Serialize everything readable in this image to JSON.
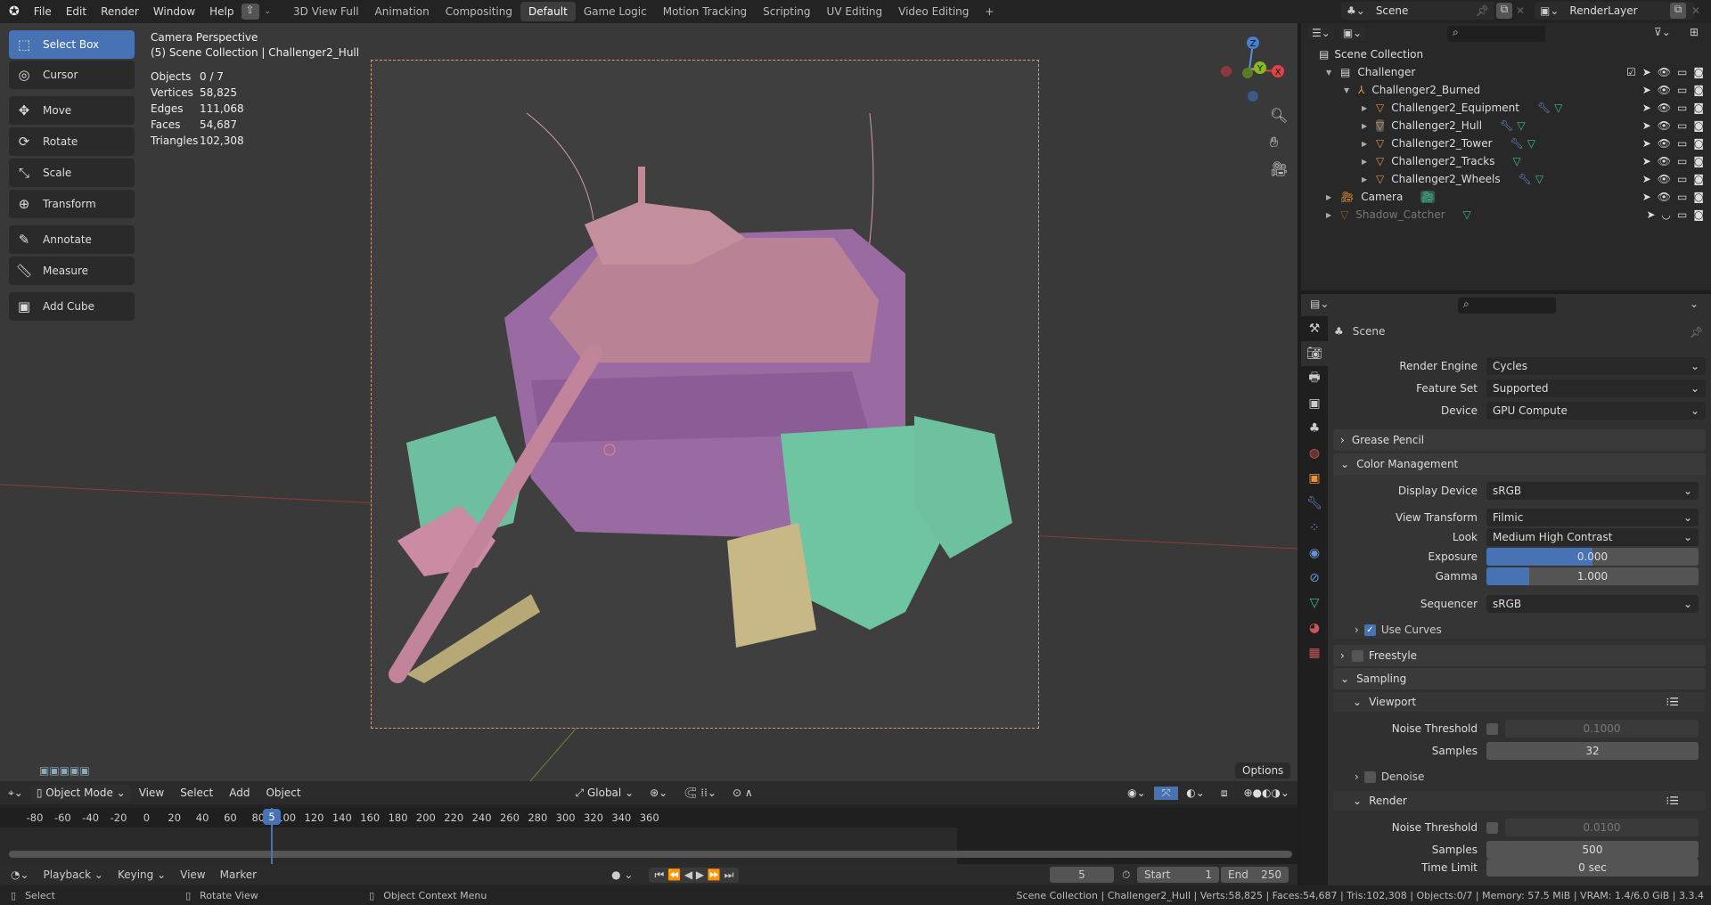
{
  "topbar": {
    "menus": [
      "File",
      "Edit",
      "Render",
      "Window",
      "Help"
    ],
    "workspaces": [
      "3D View Full",
      "Animation",
      "Compositing",
      "Default",
      "Game Logic",
      "Motion Tracking",
      "Scripting",
      "UV Editing",
      "Video Editing"
    ],
    "active_workspace": "Default",
    "add_tab": "+",
    "scene": "Scene",
    "view_layer": "RenderLayer"
  },
  "toolbar": {
    "tools": [
      "Select Box",
      "Cursor",
      "Move",
      "Rotate",
      "Scale",
      "Transform",
      "Annotate",
      "Measure",
      "Add Cube"
    ],
    "active": "Select Box"
  },
  "viewport": {
    "title": "Camera Perspective",
    "subtitle": "(5) Scene Collection | Challenger2_Hull",
    "stats": [
      {
        "k": "Objects",
        "v": "0 / 7"
      },
      {
        "k": "Vertices",
        "v": "58,825"
      },
      {
        "k": "Edges",
        "v": "111,068"
      },
      {
        "k": "Faces",
        "v": "54,687"
      },
      {
        "k": "Triangles",
        "v": "102,308"
      }
    ],
    "options": "Options",
    "gizmo": {
      "z": "Z",
      "y": "Y",
      "x": "X"
    },
    "header": {
      "mode": "Object Mode",
      "menus": [
        "View",
        "Select",
        "Add",
        "Object"
      ],
      "orientation": "Global"
    }
  },
  "timeline": {
    "ticks": [
      "-80",
      "-60",
      "-40",
      "-20",
      "0",
      "20",
      "40",
      "60",
      "80",
      "100",
      "120",
      "140",
      "160",
      "180",
      "200",
      "220",
      "240",
      "260",
      "280",
      "300",
      "320",
      "340",
      "360"
    ],
    "current_frame": "5",
    "menus": [
      "Playback",
      "Keying",
      "View",
      "Marker"
    ],
    "frame_field": "5",
    "start_label": "Start",
    "start": "1",
    "end_label": "End",
    "end": "250"
  },
  "status": {
    "hints": [
      "Select",
      "Rotate View",
      "Object Context Menu"
    ],
    "info": "Scene Collection | Challenger2_Hull | Verts:58,825 | Faces:54,687 | Tris:102,308 | Objects:0/7 | Memory: 57.5 MiB | VRAM: 1.4/6.0 GiB | 3.3.4"
  },
  "outliner": {
    "root": "Scene Collection",
    "collection": "Challenger",
    "empty": "Challenger2_Burned",
    "children": [
      "Challenger2_Equipment",
      "Challenger2_Hull",
      "Challenger2_Tower",
      "Challenger2_Tracks",
      "Challenger2_Wheels"
    ],
    "camera": "Camera",
    "shadow": "Shadow_Catcher"
  },
  "properties": {
    "context": "Scene",
    "render_engine_label": "Render Engine",
    "render_engine": "Cycles",
    "feature_set_label": "Feature Set",
    "feature_set": "Supported",
    "device_label": "Device",
    "device": "GPU Compute",
    "grease_pencil": "Grease Pencil",
    "color_management": "Color Management",
    "display_device_label": "Display Device",
    "display_device": "sRGB",
    "view_transform_label": "View Transform",
    "view_transform": "Filmic",
    "look_label": "Look",
    "look": "Medium High Contrast",
    "exposure_label": "Exposure",
    "exposure": "0.000",
    "exposure_fill": 0.5,
    "gamma_label": "Gamma",
    "gamma": "1.000",
    "gamma_fill": 0.2,
    "sequencer_label": "Sequencer",
    "sequencer": "sRGB",
    "use_curves": "Use Curves",
    "freestyle": "Freestyle",
    "sampling": "Sampling",
    "viewport_sub": "Viewport",
    "noise_label": "Noise Threshold",
    "vp_noise": "0.1000",
    "samples_label": "Samples",
    "vp_samples": "32",
    "denoise": "Denoise",
    "render_sub": "Render",
    "r_noise": "0.0100",
    "r_samples": "500",
    "time_limit_label": "Time Limit",
    "time_limit": "0 sec"
  }
}
